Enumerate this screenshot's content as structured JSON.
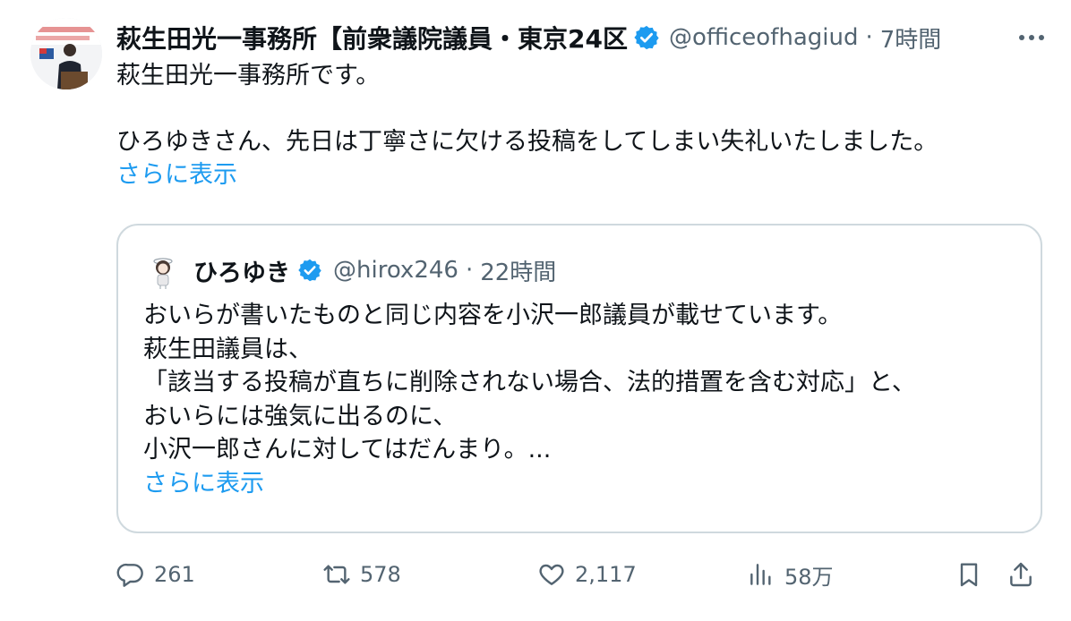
{
  "tweet": {
    "display_name": "萩生田光一事務所【前衆議院議員・東京24区",
    "handle": "@officeofhagiud",
    "separator": "·",
    "time": "7時間",
    "text_line1": "萩生田光一事務所です。",
    "text_line2": "ひろゆきさん、先日は丁寧さに欠ける投稿をしてしまい失礼いたしました。",
    "show_more": "さらに表示"
  },
  "quote": {
    "display_name": "ひろゆき",
    "handle": "@hirox246",
    "separator": "·",
    "time": "22時間",
    "lines": [
      "おいらが書いたものと同じ内容を小沢一郎議員が載せています。",
      "萩生田議員は、",
      "「該当する投稿が直ちに削除されない場合、法的措置を含む対応」と、",
      "おいらには強気に出るのに、",
      "小沢一郎さんに対してはだんまり。..."
    ],
    "show_more": "さらに表示"
  },
  "actions": {
    "replies": "261",
    "retweets": "578",
    "likes": "2,117",
    "views": "58万"
  },
  "colors": {
    "accent": "#1d9bf0",
    "secondary_text": "#536471",
    "border": "#cfd9de",
    "verified": "#1d9bf0"
  },
  "icons": {
    "verified": "verified-badge-icon",
    "more": "more-dots-icon",
    "reply": "reply-icon",
    "retweet": "retweet-icon",
    "like": "heart-icon",
    "views": "views-chart-icon",
    "bookmark": "bookmark-icon",
    "share": "share-icon"
  }
}
